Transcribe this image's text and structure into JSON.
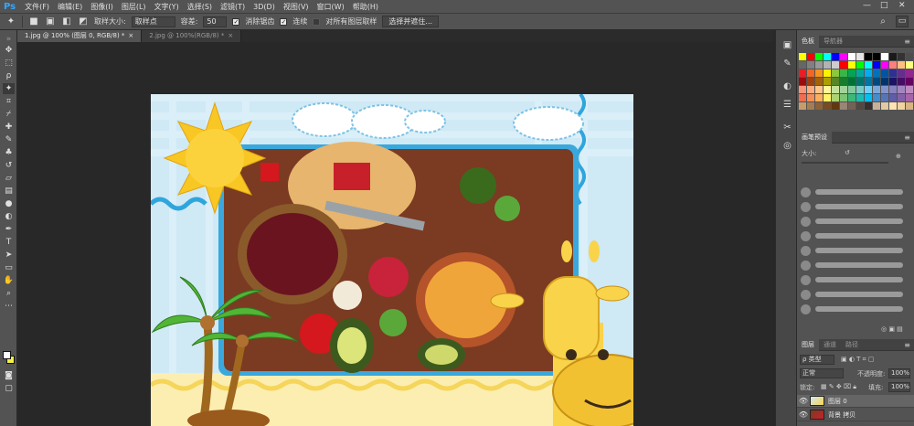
{
  "app": {
    "logo": "Ps"
  },
  "menu": [
    "文件(F)",
    "编辑(E)",
    "图像(I)",
    "图层(L)",
    "文字(Y)",
    "选择(S)",
    "滤镜(T)",
    "3D(D)",
    "视图(V)",
    "窗口(W)",
    "帮助(H)"
  ],
  "window_controls": {
    "minimize": "—",
    "maximize": "□",
    "close": "✕"
  },
  "options": {
    "sample_size_label": "取样大小:",
    "sample_size_value": "取样点",
    "tolerance_label": "容差:",
    "tolerance_value": "50",
    "antialias_label": "消除锯齿",
    "contiguous_label": "连续",
    "all_layers_label": "对所有图层取样",
    "select_subject_button": "选择并遮住..."
  },
  "tabs": [
    {
      "label": "1.jpg @ 100% (图层 0, RGB/8) *",
      "close": "×"
    },
    {
      "label": "2.jpg @ 100%(RGB/8) *",
      "close": "×"
    }
  ],
  "panels": {
    "color_tabs": [
      "色板",
      "导航器"
    ],
    "brush_tabs": [
      "画笔预设"
    ],
    "brush_size_label": "大小:",
    "layer_tabs": [
      "图层",
      "通道",
      "路径"
    ],
    "kind_filter": "ρ 类型",
    "blend_mode": "正常",
    "opacity_label": "不透明度:",
    "opacity_value": "100%",
    "lock_label": "锁定:",
    "fill_label": "填充:",
    "fill_value": "100%",
    "layers": [
      {
        "name": "图层 0",
        "active": true
      },
      {
        "name": "背景 拷贝",
        "active": false
      }
    ]
  },
  "swatch_colors": [
    "#ffff00",
    "#ff0000",
    "#00ff00",
    "#00ffff",
    "#0000ff",
    "#ff00ff",
    "#ffffff",
    "#e5e5e5",
    "#000000",
    "#000000",
    "#ffffff",
    "#1a1a1a",
    "#333333",
    "#4d4d4d",
    "#666666",
    "#808080",
    "#999999",
    "#b3b3b3",
    "#cccccc",
    "#ff0000",
    "#ffff00",
    "#00ff00",
    "#00ffff",
    "#0000ff",
    "#ff00ff",
    "#ff7f7f",
    "#ffbf7f",
    "#ffff7f",
    "#ed1c24",
    "#f26522",
    "#f7941d",
    "#fff200",
    "#8dc63f",
    "#39b54a",
    "#00a651",
    "#00a99d",
    "#00aeef",
    "#0072bc",
    "#0054a6",
    "#2e3192",
    "#662d91",
    "#92278f",
    "#9e0b0f",
    "#a0410d",
    "#a36209",
    "#aba000",
    "#598527",
    "#197b30",
    "#007236",
    "#00746b",
    "#0076a3",
    "#004a80",
    "#003471",
    "#1b1464",
    "#440e62",
    "#630460",
    "#f69679",
    "#f9ad81",
    "#fdc68a",
    "#fff799",
    "#c4df9b",
    "#a3d39c",
    "#82ca9d",
    "#7accc8",
    "#6dcff6",
    "#7da7d9",
    "#8393ca",
    "#8781bd",
    "#a186be",
    "#bd8cbf",
    "#f26c4f",
    "#f68e56",
    "#fbaf5d",
    "#fff467",
    "#acd373",
    "#7cc576",
    "#3cb878",
    "#1cbbb4",
    "#00bff3",
    "#448ccb",
    "#5674b9",
    "#605ca8",
    "#8560a8",
    "#a864a8",
    "#c69c6d",
    "#a67c52",
    "#8c6239",
    "#754c24",
    "#603913",
    "#998675",
    "#736357",
    "#534741",
    "#362f2d",
    "#c7b299",
    "#e1c9a5",
    "#ffe3b5",
    "#f2d4a1",
    "#d9b382"
  ]
}
